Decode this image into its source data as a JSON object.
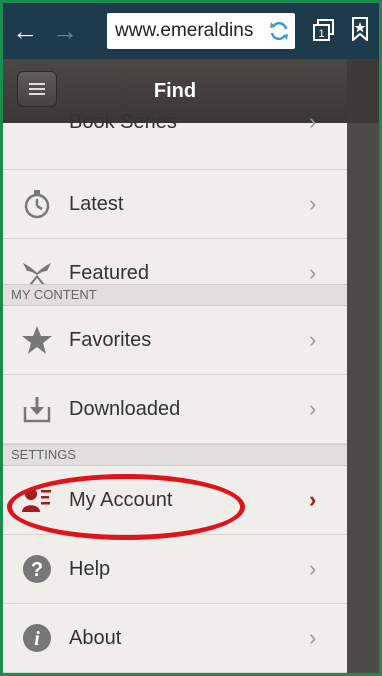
{
  "browser": {
    "url": "www.emeraldins",
    "back_label": "←",
    "forward_label": "→",
    "tabs_count": "1"
  },
  "header": {
    "title": "Find"
  },
  "menu": {
    "partial_item": "Book Series",
    "items": [
      {
        "label": "Latest",
        "icon": "stopwatch-icon"
      },
      {
        "label": "Featured",
        "icon": "ribbon-icon"
      }
    ],
    "my_content_title": "MY CONTENT",
    "my_content_items": [
      {
        "label": "Favorites",
        "icon": "star-icon"
      },
      {
        "label": "Downloaded",
        "icon": "download-icon"
      }
    ],
    "settings_title": "SETTINGS",
    "settings_items": [
      {
        "label": "My Account",
        "icon": "account-icon"
      },
      {
        "label": "Help",
        "icon": "help-icon"
      },
      {
        "label": "About",
        "icon": "info-icon"
      }
    ],
    "chevron": "›"
  },
  "colors": {
    "accent_red": "#e0121b",
    "account_icon": "#a11c1c",
    "frame_green": "#1a8c4e",
    "toolbar": "#1e3a4d"
  }
}
